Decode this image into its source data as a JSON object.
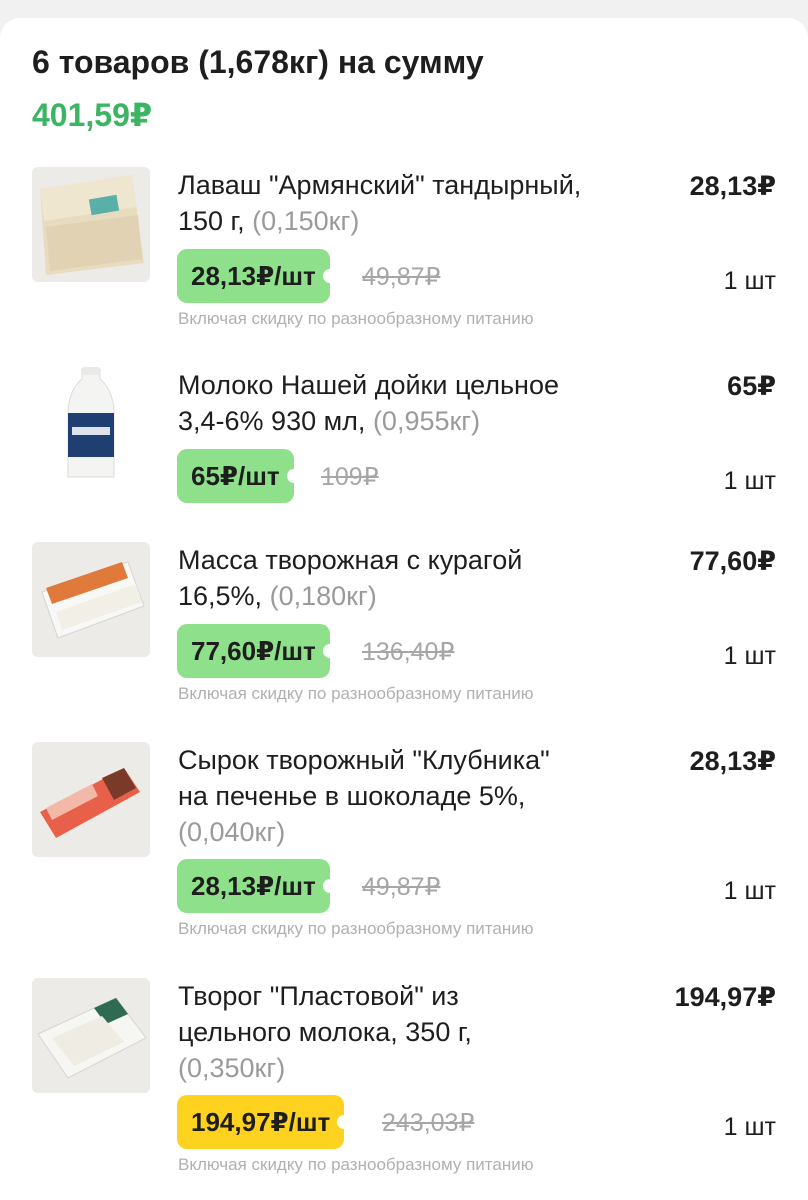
{
  "summary": {
    "title": "6 товаров (1,678кг) на сумму",
    "total": "401,59₽"
  },
  "colors": {
    "accent_green": "#3cb562",
    "tag_green": "#8ee08a",
    "tag_yellow": "#ffd21f"
  },
  "items": [
    {
      "name_line1": "Лаваш \"Армянский\" тандырный,",
      "name_line2": "150 г,",
      "weight": "(0,150кг)",
      "line_total": "28,13₽",
      "unit_price": "28,13₽/шт",
      "old_price": "49,87₽",
      "qty": "1 шт",
      "note": "Включая скидку по разнообразному питанию",
      "image": "lavash-package"
    },
    {
      "name_line1": "Молоко Нашей дойки цельное",
      "name_line2": "3,4-6% 930 мл,",
      "weight": "(0,955кг)",
      "line_total": "65₽",
      "unit_price": "65₽/шт",
      "old_price": "109₽",
      "qty": "1 шт",
      "image": "milk-bottle"
    },
    {
      "name_line1": "Масса творожная с курагой",
      "name_line2": "16,5%,",
      "weight": "(0,180кг)",
      "line_total": "77,60₽",
      "unit_price": "77,60₽/шт",
      "old_price": "136,40₽",
      "qty": "1 шт",
      "note": "Включая скидку по разнообразному питанию",
      "image": "curd-container"
    },
    {
      "name_line1": "Сырок творожный \"Клубника\"",
      "name_line2": "на печенье в шоколаде 5%,",
      "weight": "(0,040кг)",
      "line_total": "28,13₽",
      "unit_price": "28,13₽/шт",
      "old_price": "49,87₽",
      "qty": "1 шт",
      "note": "Включая скидку по разнообразному питанию",
      "image": "curd-bar"
    },
    {
      "name_line1": "Творог \"Пластовой\" из",
      "name_line2": "цельного молока, 350 г,",
      "weight": "(0,350кг)",
      "line_total": "194,97₽",
      "unit_price": "194,97₽/шт",
      "old_price": "243,03₽",
      "qty": "1 шт",
      "note": "Включая скидку по разнообразному питанию",
      "image": "cottage-cheese-tub"
    }
  ]
}
